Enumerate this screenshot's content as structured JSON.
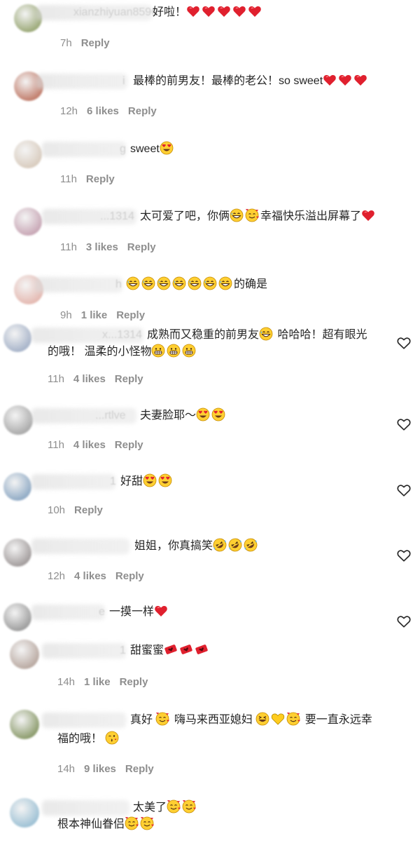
{
  "comments": [
    {
      "user_fragment": "xianzhiyuan8596",
      "text": "好啦！",
      "emojis": [
        "red-heart",
        "red-heart",
        "red-heart",
        "red-heart",
        "red-heart"
      ],
      "time": "7h",
      "likes": "",
      "reply": "Reply",
      "avatar_color": "#9aa876"
    },
    {
      "user_fragment": "i",
      "text": "最棒的前男友！最棒的老公！so sweet",
      "emojis": [
        "red-heart",
        "red-heart",
        "red-heart"
      ],
      "time": "12h",
      "likes": "6 likes",
      "reply": "Reply",
      "avatar_color": "#c07a68"
    },
    {
      "user_fragment": "g",
      "text": "sweet",
      "emojis": [
        "heart-eyes"
      ],
      "time": "11h",
      "likes": "",
      "reply": "Reply",
      "avatar_color": "#d8cbbd"
    },
    {
      "user_fragment": "...1314",
      "text": "太可爱了吧，你俩",
      "emojis": [
        "grin-sweat",
        "smiling-hearts"
      ],
      "text2": "幸福快乐溢出屏幕了",
      "emojis2": [
        "red-heart"
      ],
      "time": "11h",
      "likes": "3 likes",
      "reply": "Reply",
      "avatar_color": "#c7a5b4"
    },
    {
      "user_fragment": "h",
      "text": "",
      "emojis": [
        "grin-sweat",
        "grin-sweat",
        "grin-sweat",
        "grin-sweat",
        "grin-sweat",
        "grin-sweat",
        "grin-sweat"
      ],
      "text2": "的确是",
      "time": "9h",
      "likes": "1 like",
      "reply": "Reply",
      "avatar_color": "#e4b8b0"
    },
    {
      "user_fragment": "x...1314",
      "text": "成熟而又稳重的前男友",
      "emojis": [
        "grin-sweat"
      ],
      "text2": " 哈哈哈！超有眼光",
      "line2": "的哦！ 温柔的小怪物",
      "emojis_line2": [
        "grimace",
        "grimace",
        "grimace"
      ],
      "time": "11h",
      "likes": "4 likes",
      "reply": "Reply",
      "avatar_color": "#a5b2c8"
    },
    {
      "user_fragment": "...rtlve",
      "text": "夫妻脸耶～",
      "emojis": [
        "heart-eyes",
        "heart-eyes"
      ],
      "time": "11h",
      "likes": "4 likes",
      "reply": "Reply",
      "avatar_color": "#a8a8a8"
    },
    {
      "user_fragment": "1",
      "text": "好甜",
      "emojis": [
        "heart-eyes",
        "heart-eyes"
      ],
      "time": "10h",
      "likes": "",
      "reply": "Reply",
      "avatar_color": "#8ea9c4"
    },
    {
      "user_fragment": "",
      "text": "姐姐，你真搞笑",
      "emojis": [
        "rofl",
        "rofl",
        "rofl"
      ],
      "time": "12h",
      "likes": "4 likes",
      "reply": "Reply",
      "avatar_color": "#a09a9a"
    },
    {
      "user_fragment": "e",
      "text": "一摸一样",
      "emojis": [
        "red-heart"
      ],
      "time": "",
      "likes": "",
      "reply": "",
      "avatar_color": "#9b9b9b"
    },
    {
      "user_fragment": "1",
      "text": "甜蜜蜜",
      "emojis": [
        "heart-box",
        "heart-box",
        "heart-box"
      ],
      "time": "14h",
      "likes": "1 like",
      "reply": "Reply",
      "avatar_color": "#b8a8a0"
    },
    {
      "user_fragment": "",
      "text": "真好 ",
      "emojis": [
        "smiling-hearts"
      ],
      "text2": " 嗨马来西亚媳妇 ",
      "emojis2": [
        "laugh-closed",
        "yellow-heart",
        "smiling-hearts"
      ],
      "text3": " 要一直永远幸",
      "line2": "福的哦！ ",
      "emojis_line2": [
        "kiss-wink"
      ],
      "time": "14h",
      "likes": "9 likes",
      "reply": "Reply",
      "avatar_color": "#8a9a6a"
    },
    {
      "user_fragment": "",
      "text": "太美了",
      "emojis": [
        "smiling-hearts",
        "smiling-hearts"
      ],
      "line2": "根本神仙眷侣",
      "emojis_line2": [
        "smiling-hearts",
        "smiling-hearts"
      ],
      "time": "",
      "likes": "",
      "reply": "",
      "avatar_color": "#9cc0d4"
    }
  ],
  "icons": {
    "like": "heart-outline-icon"
  }
}
